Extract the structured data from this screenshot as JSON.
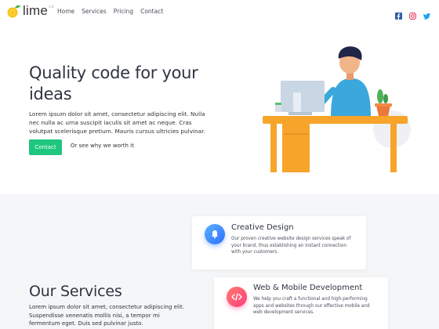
{
  "brand": {
    "name": "lime",
    "version": "1.0"
  },
  "nav": {
    "items": [
      "Home",
      "Services",
      "Pricing",
      "Contact"
    ]
  },
  "social": [
    "facebook-icon",
    "instagram-icon",
    "twitter-icon"
  ],
  "hero": {
    "title": "Quality code for your ideas",
    "text": "Lorem ipsum dolor sit amet, consectetur adipiscing elit. Nulla nec nulla ac urna suscipit iaculis sit amet ac neque. Cras volutpat scelerisque pretium. Mauris cursus ultricies pulvinar.",
    "contact_button": "Contact",
    "secondary_link": "Or see why we worth it"
  },
  "services": {
    "title": "Our Services",
    "text": "Lorem ipsum dolor sit amet, consectetur adipiscing elit. Suspendisse venenatis mollis nisi, a tempor mi fermentum eget. Duis sed pulvinar justo.",
    "cards": [
      {
        "title": "Creative Design",
        "text": "Our proven creative website design services speak of your brand, thus establishing an instant connection with your customers.",
        "icon": "bell-icon"
      },
      {
        "title": "Web & Mobile Development",
        "text": "We help you craft a functional and high-performing apps and websites through our effective mobile and web development services.",
        "icon": "code-icon"
      }
    ]
  },
  "colors": {
    "accent": "#1fc77e",
    "text": "#2f3441",
    "section_bg": "#f5f6f8",
    "desk": "#f7a42b"
  }
}
